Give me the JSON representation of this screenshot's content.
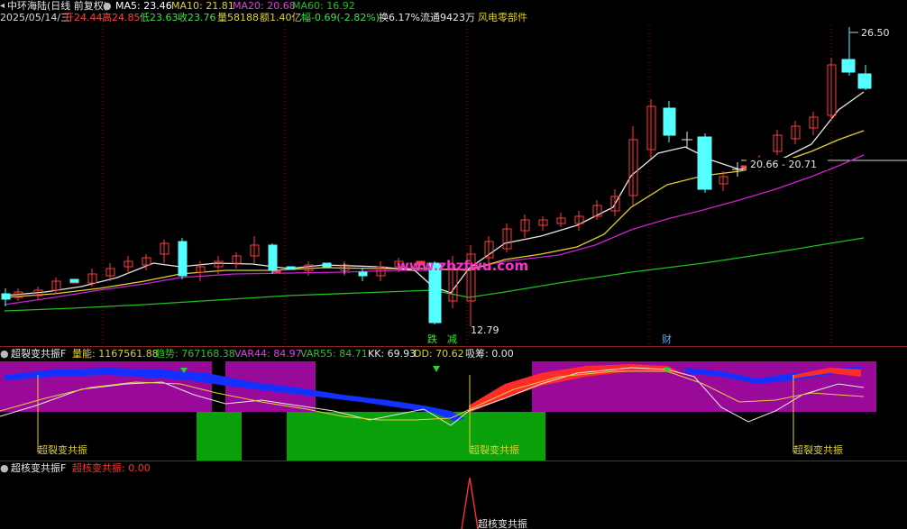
{
  "main_panel": {
    "title": "中环海陆(日线 前复权)",
    "ma5": "MA5: 23.46",
    "ma10": "MA10: 21.81",
    "ma20": "MA20: 20.68",
    "ma60": "MA60: 16.92",
    "date": "2025/05/14/三",
    "open": "开24.44",
    "high": "高24.85",
    "low": "低23.63",
    "close": "收23.76",
    "volume": "量58188",
    "amount": "额1.40亿",
    "change": "幅-0.69(-2.82%)",
    "turnover": "换6.17%",
    "float": "流通9423万",
    "sector": "风电零部件",
    "price_high_label": "26.50",
    "price_low_label": "12.79",
    "crosshair_label": "20.66 - 20.71",
    "marker_left": "跌",
    "marker_mid": "减",
    "marker_cai": "财",
    "watermark": "www.zbzfwu.com"
  },
  "indicator1": {
    "name": "超裂变共振F",
    "vol_label": "量能: 1167561.88",
    "trend_label": "趋势: 767168.38",
    "var44": "VAR44: 84.97",
    "var55": "VAR55: 84.71",
    "kk": "KK: 69.93",
    "dd": "DD: 70.62",
    "xichou": "吸筹: 0.00",
    "signal_label": "超裂变共振"
  },
  "indicator2": {
    "name": "超核变共振F",
    "value_label": "超核变共振: 0.00",
    "signal_label": "超核变共振"
  },
  "colors": {
    "up": "#ff3b3b",
    "down": "#54ffff",
    "ma5": "#ffffff",
    "ma10": "#e0d030",
    "ma20": "#d020d0",
    "ma60": "#20c020",
    "separator": "#8a1f1f"
  },
  "chart_data": {
    "type": "candlestick",
    "price_labels": {
      "high": 26.5,
      "low": 12.79
    },
    "ma_values": {
      "MA5": 23.46,
      "MA10": 21.81,
      "MA20": 20.68,
      "MA60": 16.92
    }
  }
}
